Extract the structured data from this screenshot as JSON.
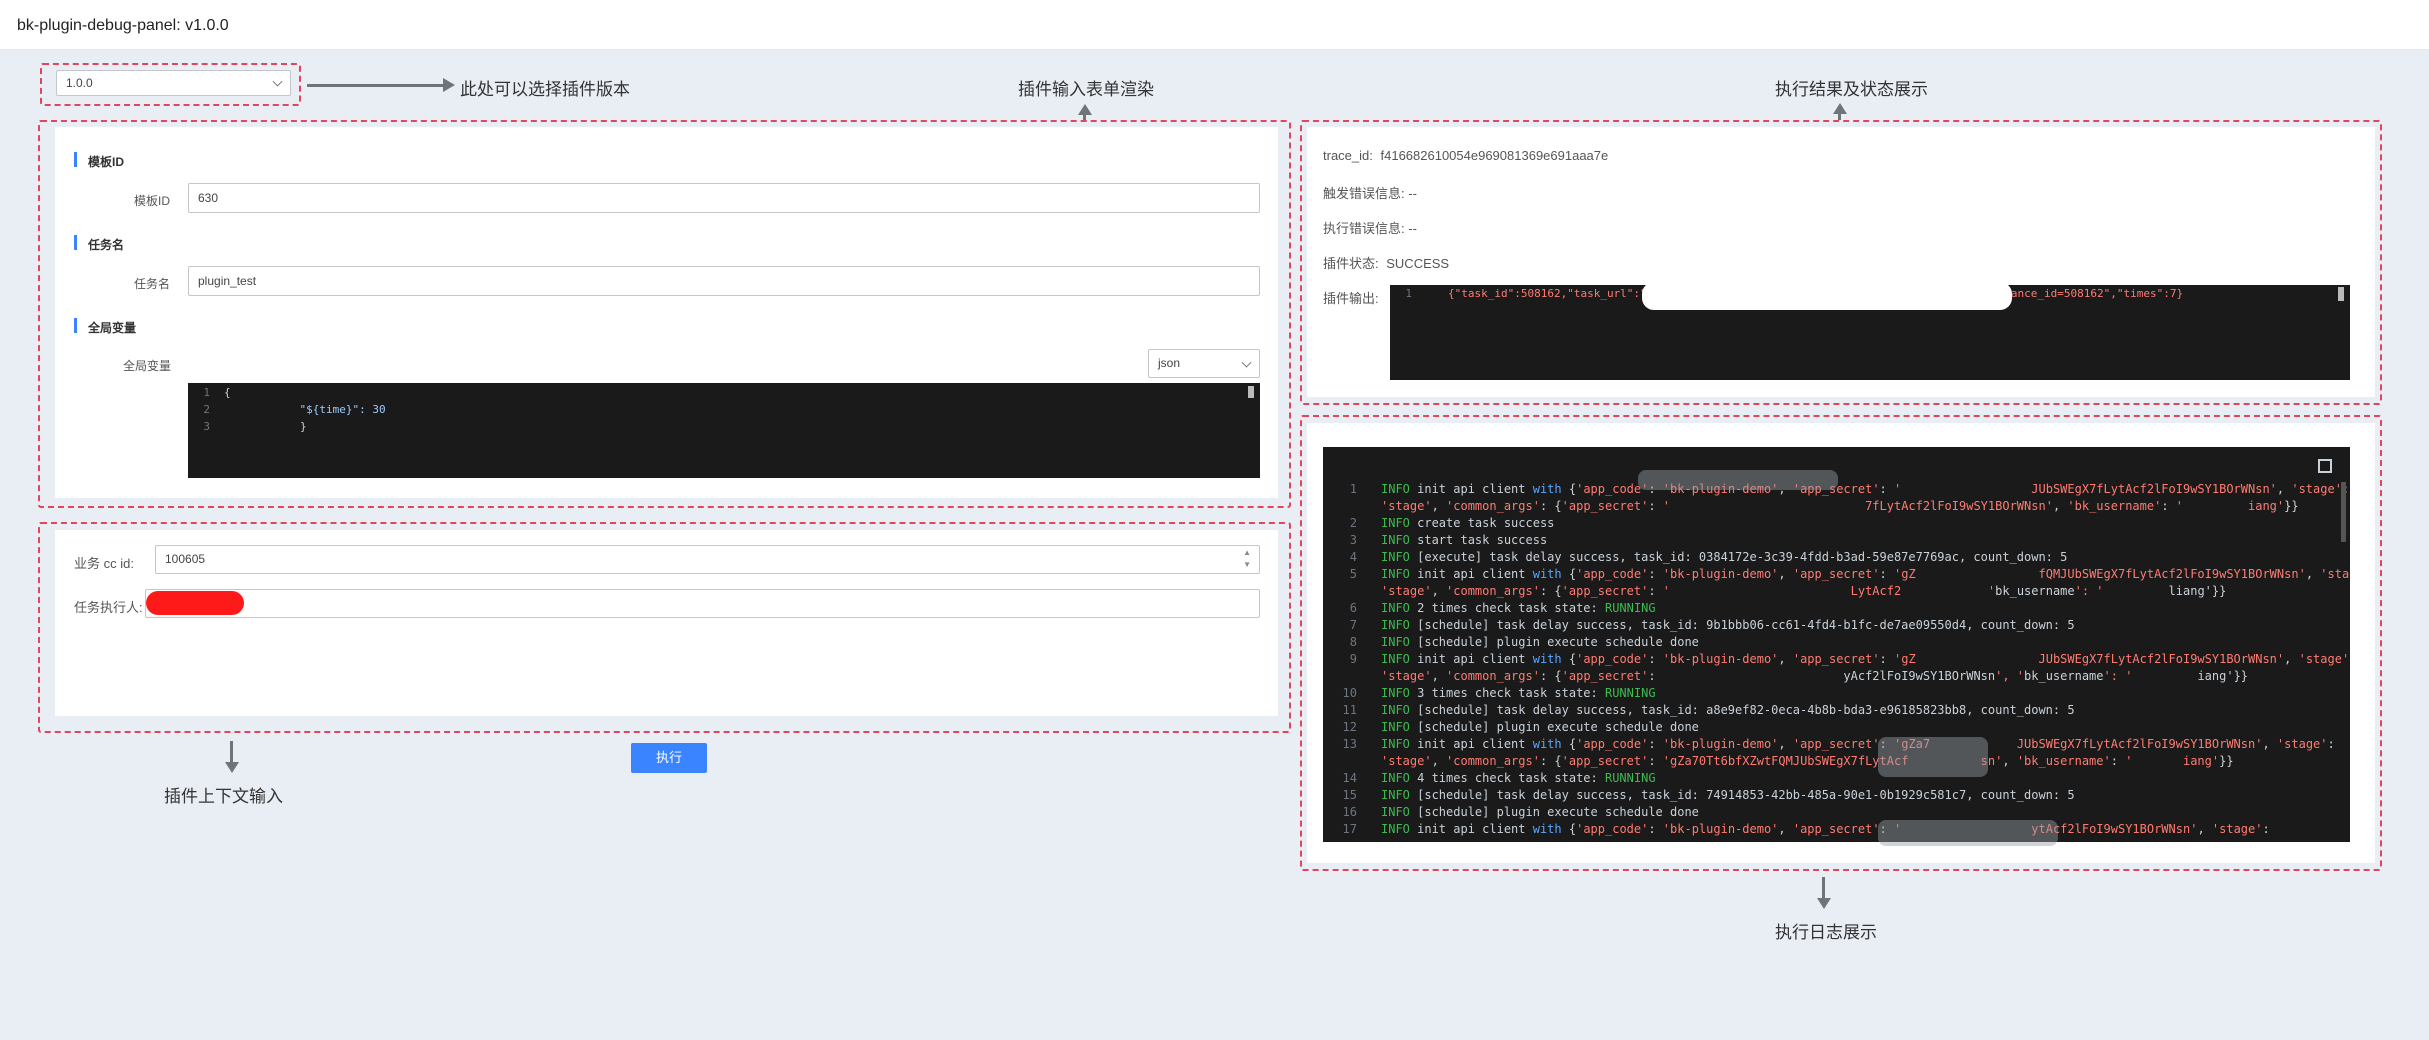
{
  "app": {
    "title": "bk-plugin-debug-panel: v1.0.0"
  },
  "version_select": {
    "value": "1.0.0",
    "options": [
      "1.0.0"
    ]
  },
  "annotations": {
    "version": "此处可以选择插件版本",
    "form": "插件输入表单渲染",
    "result": "执行结果及状态展示",
    "context": "插件上下文输入",
    "log": "执行日志展示"
  },
  "form": {
    "sections": [
      {
        "title": "模板ID",
        "label": "模板ID",
        "value": "630"
      },
      {
        "title": "任务名",
        "label": "任务名",
        "value": "plugin_test"
      },
      {
        "title": "全局变量",
        "label": "全局变量"
      }
    ],
    "format_select": {
      "value": "json"
    },
    "editor_lines": [
      {
        "n": "1",
        "text": "{"
      },
      {
        "n": "2",
        "text": "    \"${time}\": 30"
      },
      {
        "n": "3",
        "text": "}"
      }
    ]
  },
  "context": {
    "cc_id_label": "业务 cc id:",
    "cc_id_value": "100605",
    "executor_label": "任务执行人:",
    "executor_value": ""
  },
  "execute_button": {
    "label": "执行"
  },
  "result": {
    "trace_label": "trace_id:",
    "trace_value": "f416682610054e969081369e691aaa7e",
    "trigger_error_label": "触发错误信息:",
    "trigger_error_value": "--",
    "exec_error_label": "执行错误信息:",
    "exec_error_value": "--",
    "status_label": "插件状态:",
    "status_value": "SUCCESS",
    "output_label": "插件输出:",
    "output_line_no": "1",
    "output_text": "{\"task_id\":508162,\"task_url\":\"                                              356/?instance_id=508162\",\"times\":7}"
  },
  "log": {
    "lines": [
      {
        "n": "1",
        "text": "INFO init api client with {'app_code': 'bk-plugin-demo', 'app_secret': '                  JUbSWEgX7fLytAcf2lFoI9wSY1BOrWNsn', 'stage':"
      },
      {
        "n": "",
        "text": "'stage', 'common_args': {'app_secret': '                           7fLytAcf2lFoI9wSY1BOrWNsn', 'bk_username': '         iang'}}"
      },
      {
        "n": "2",
        "text": "INFO create task success"
      },
      {
        "n": "3",
        "text": "INFO start task success"
      },
      {
        "n": "4",
        "text": "INFO [execute] task delay success, task_id: 0384172e-3c39-4fdd-b3ad-59e87e7769ac, count_down: 5"
      },
      {
        "n": "5",
        "text": "INFO init api client with {'app_code': 'bk-plugin-demo', 'app_secret': 'gZ                 fQMJUbSWEgX7fLytAcf2lFoI9wSY1BOrWNsn', 'stage':"
      },
      {
        "n": "",
        "text": "'stage', 'common_args': {'app_secret': '                         LytAcf2            'bk_username': '         liang'}}"
      },
      {
        "n": "6",
        "text": "INFO 2 times check task state: RUNNING"
      },
      {
        "n": "7",
        "text": "INFO [schedule] task delay success, task_id: 9b1bbb06-cc61-4fd4-b1fc-de7ae09550d4, count_down: 5"
      },
      {
        "n": "8",
        "text": "INFO [schedule] plugin execute schedule done"
      },
      {
        "n": "9",
        "text": "INFO init api client with {'app_code': 'bk-plugin-demo', 'app_secret': 'gZ                 JUbSWEgX7fLytAcf2lFoI9wSY1BOrWNsn', 'stage':"
      },
      {
        "n": "",
        "text": "'stage', 'common_args': {'app_secret':                          yAcf2lFoI9wSY1BOrWNsn', 'bk_username': '         iang'}}"
      },
      {
        "n": "10",
        "text": "INFO 3 times check task state: RUNNING"
      },
      {
        "n": "11",
        "text": "INFO [schedule] task delay success, task_id: a8e9ef82-0eca-4b8b-bda3-e96185823bb8, count_down: 5"
      },
      {
        "n": "12",
        "text": "INFO [schedule] plugin execute schedule done"
      },
      {
        "n": "13",
        "text": "INFO init api client with {'app_code': 'bk-plugin-demo', 'app_secret': 'gZa7            JUbSWEgX7fLytAcf2lFoI9wSY1BOrWNsn', 'stage':"
      },
      {
        "n": "",
        "text": "'stage', 'common_args': {'app_secret': 'gZa70Tt6bfXZwtFQMJUbSWEgX7fLytAcf          sn', 'bk_username': '       iang'}}"
      },
      {
        "n": "14",
        "text": "INFO 4 times check task state: RUNNING"
      },
      {
        "n": "15",
        "text": "INFO [schedule] task delay success, task_id: 74914853-42bb-485a-90e1-0b1929c581c7, count_down: 5"
      },
      {
        "n": "16",
        "text": "INFO [schedule] plugin execute schedule done"
      },
      {
        "n": "17",
        "text": "INFO init api client with {'app_code': 'bk-plugin-demo', 'app_secret': '                  ytAcf2lFoI9wSY1BOrWNsn', 'stage':"
      }
    ]
  },
  "colors": {
    "accent": "#3a84ff",
    "dash": "#e0465e",
    "log_bg": "#1a1a1a"
  }
}
